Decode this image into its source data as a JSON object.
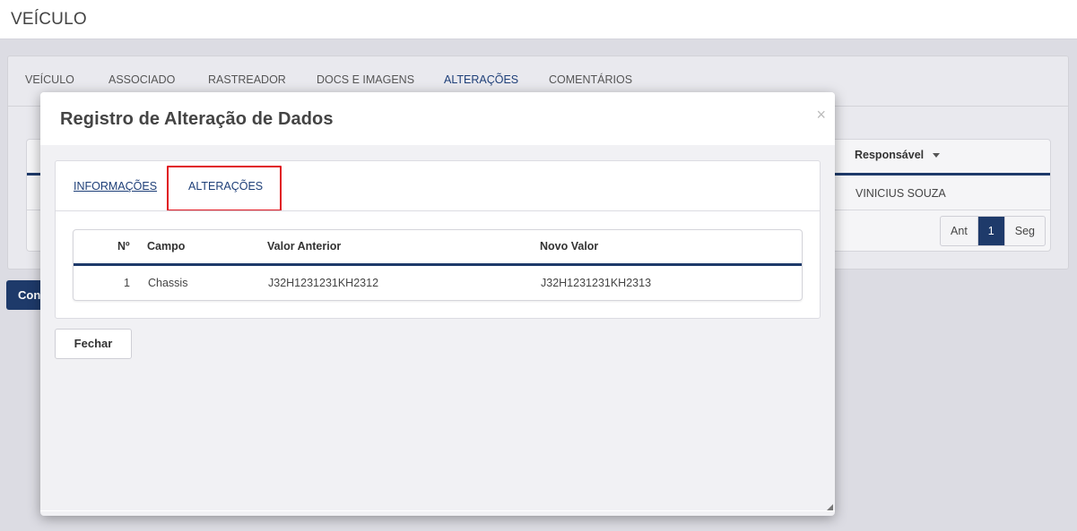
{
  "page": {
    "title": "VEÍCULO"
  },
  "main_tabs": [
    {
      "label": "VEÍCULO",
      "active": false
    },
    {
      "label": "ASSOCIADO",
      "active": false
    },
    {
      "label": "RASTREADOR",
      "active": false
    },
    {
      "label": "DOCS E IMAGENS",
      "active": false
    },
    {
      "label": "ALTERAÇÕES",
      "active": true
    },
    {
      "label": "COMENTÁRIOS",
      "active": false
    }
  ],
  "background_table": {
    "header_responsavel": "Responsável",
    "row_responsavel": "VINICIUS SOUZA",
    "pager": {
      "prev": "Ant",
      "current": "1",
      "next": "Seg"
    }
  },
  "confirm_button_label": "Con",
  "modal": {
    "title": "Registro de Alteração de Dados",
    "close_glyph": "×",
    "tabs": [
      {
        "label": "INFORMAÇÕES",
        "active": false
      },
      {
        "label": "ALTERAÇÕES",
        "active": true
      }
    ],
    "table": {
      "headers": {
        "num": "Nº",
        "campo": "Campo",
        "valor_anterior": "Valor Anterior",
        "novo_valor": "Novo Valor"
      },
      "rows": [
        {
          "num": "1",
          "campo": "Chassis",
          "valor_anterior": "J32H1231231KH2312",
          "novo_valor": "J32H1231231KH2313"
        }
      ]
    },
    "close_button_label": "Fechar"
  },
  "colors": {
    "accent": "#1e3a6a",
    "highlight": "#e0141e",
    "backdrop": "#dcdce3"
  }
}
